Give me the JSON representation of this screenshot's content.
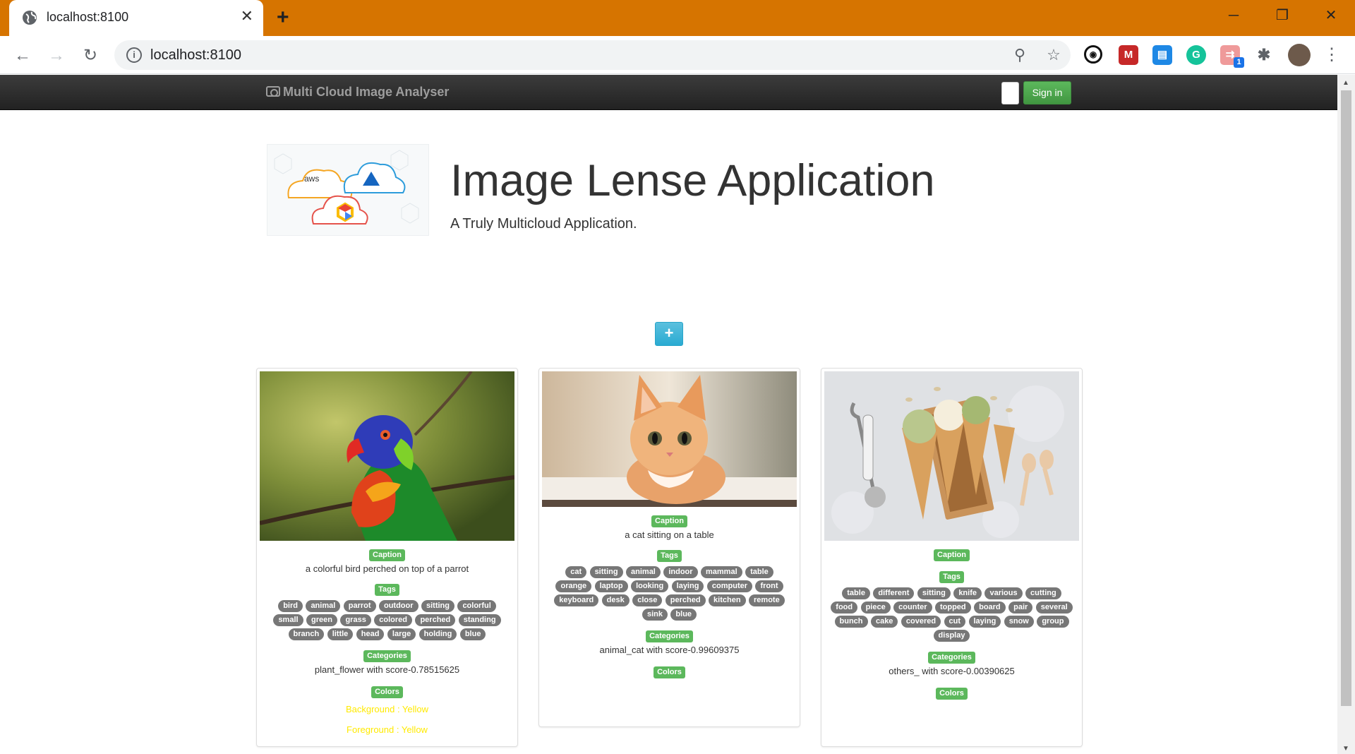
{
  "browser": {
    "tab_title": "localhost:8100",
    "url": "localhost:8100",
    "extension_badge": "1"
  },
  "navbar": {
    "brand": "Multi Cloud Image Analyser",
    "signin_label": "Sign in"
  },
  "hero": {
    "logo_text": "aws",
    "title": "Image Lense Application",
    "subtitle": "A Truly Multicloud Application."
  },
  "add_button_label": "+",
  "cards": [
    {
      "caption_label": "Caption",
      "caption": "a colorful bird perched on top of a parrot",
      "tags_label": "Tags",
      "tags": [
        "bird",
        "animal",
        "parrot",
        "outdoor",
        "sitting",
        "colorful",
        "small",
        "green",
        "grass",
        "colored",
        "perched",
        "standing",
        "branch",
        "little",
        "head",
        "large",
        "holding",
        "blue"
      ],
      "categories_label": "Categories",
      "category": "plant_flower with score-0.78515625",
      "colors_label": "Colors",
      "background_color": "Background : Yellow",
      "foreground_color": "Foreground : Yellow"
    },
    {
      "caption_label": "Caption",
      "caption": "a cat sitting on a table",
      "tags_label": "Tags",
      "tags": [
        "cat",
        "sitting",
        "animal",
        "indoor",
        "mammal",
        "table",
        "orange",
        "laptop",
        "looking",
        "laying",
        "computer",
        "front",
        "keyboard",
        "desk",
        "close",
        "perched",
        "kitchen",
        "remote",
        "sink",
        "blue"
      ],
      "categories_label": "Categories",
      "category": "animal_cat with score-0.99609375",
      "colors_label": "Colors"
    },
    {
      "caption_label": "Caption",
      "caption": "",
      "tags_label": "Tags",
      "tags": [
        "table",
        "different",
        "sitting",
        "knife",
        "various",
        "cutting",
        "food",
        "piece",
        "counter",
        "topped",
        "board",
        "pair",
        "several",
        "bunch",
        "cake",
        "covered",
        "cut",
        "laying",
        "snow",
        "group",
        "display"
      ],
      "categories_label": "Categories",
      "category": "others_ with score-0.00390625",
      "colors_label": "Colors"
    }
  ],
  "colors": {
    "tab_strip": "#d67400",
    "label_green": "#5cb85c",
    "tag_grey": "#777777",
    "color_text": "#ffea00",
    "add_button": "#5bc0de"
  }
}
